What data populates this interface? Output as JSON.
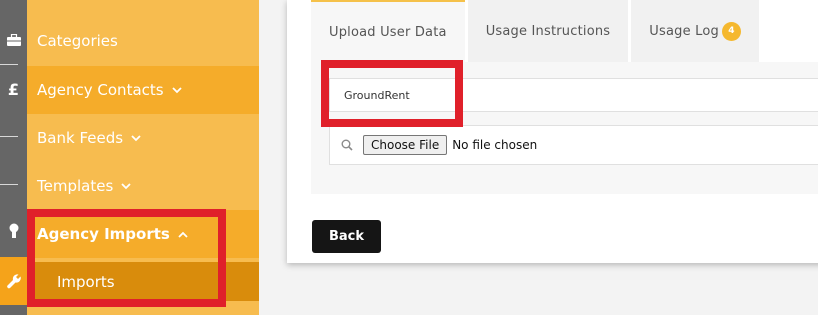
{
  "colors": {
    "rail": "#666666",
    "nav": "#f7bc4f",
    "nav_alt": "#f5ac2a",
    "nav_sub": "#d98c0c",
    "accent": "#f5a31a",
    "highlight": "#e0202a",
    "back_button": "#151515"
  },
  "rail": {
    "icons": [
      "briefcase-icon",
      "pound-icon",
      "keyhole-icon",
      "wrench-icon"
    ],
    "pound_glyph": "£"
  },
  "sidebar": {
    "items": [
      {
        "label": "Categories"
      },
      {
        "label": "Agency Contacts",
        "icon": "chevron-down-icon"
      },
      {
        "label": "Bank Feeds",
        "icon": "chevron-down-icon"
      },
      {
        "label": "Templates",
        "icon": "chevron-down-icon"
      },
      {
        "label": "Agency Imports",
        "icon": "chevron-up-icon",
        "expanded": true
      },
      {
        "label": "Imports",
        "selected": true
      }
    ]
  },
  "tabs": [
    {
      "label": "Upload User Data",
      "active": true
    },
    {
      "label": "Usage Instructions"
    },
    {
      "label": "Usage Log",
      "badge": "4"
    }
  ],
  "form": {
    "name_value": "GroundRent",
    "choose_file_label": "Choose File",
    "file_status": "No file chosen"
  },
  "actions": {
    "back_label": "Back"
  }
}
